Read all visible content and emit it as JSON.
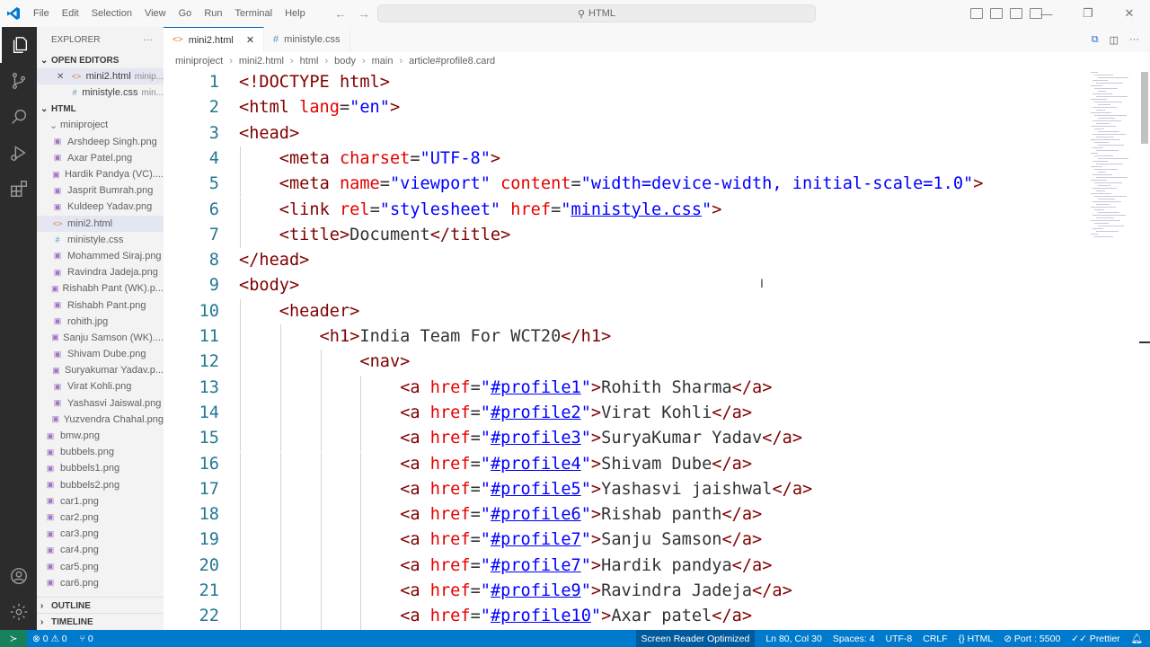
{
  "titlebar": {
    "menu": [
      "File",
      "Edit",
      "Selection",
      "View",
      "Go",
      "Run",
      "Terminal",
      "Help"
    ],
    "search": "HTML"
  },
  "sidebar": {
    "title": "EXPLORER",
    "open_editors_label": "OPEN EDITORS",
    "open_editors": [
      {
        "name": "mini2.html",
        "desc": "minip...",
        "type": "html"
      },
      {
        "name": "ministyle.css",
        "desc": "min...",
        "type": "css"
      }
    ],
    "folder_label": "HTML",
    "subfolder": "miniproject",
    "subfiles": [
      {
        "name": "Arshdeep Singh.png",
        "type": "img"
      },
      {
        "name": "Axar Patel.png",
        "type": "img"
      },
      {
        "name": "Hardik Pandya (VC)....",
        "type": "img"
      },
      {
        "name": "Jasprit Bumrah.png",
        "type": "img"
      },
      {
        "name": "Kuldeep Yadav.png",
        "type": "img"
      },
      {
        "name": "mini2.html",
        "type": "html"
      },
      {
        "name": "ministyle.css",
        "type": "css"
      },
      {
        "name": "Mohammed Siraj.png",
        "type": "img"
      },
      {
        "name": "Ravindra Jadeja.png",
        "type": "img"
      },
      {
        "name": "Rishabh Pant (WK).p...",
        "type": "img"
      },
      {
        "name": "Rishabh Pant.png",
        "type": "img"
      },
      {
        "name": "rohith.jpg",
        "type": "img"
      },
      {
        "name": "Sanju Samson (WK)....",
        "type": "img"
      },
      {
        "name": "Shivam Dube.png",
        "type": "img"
      },
      {
        "name": "Suryakumar Yadav.p...",
        "type": "img"
      },
      {
        "name": "Virat Kohli.png",
        "type": "img"
      },
      {
        "name": "Yashasvi Jaiswal.png",
        "type": "img"
      },
      {
        "name": "Yuzvendra Chahal.png",
        "type": "img"
      }
    ],
    "rootfiles": [
      "bmw.png",
      "bubbels.png",
      "bubbels1.png",
      "bubbels2.png",
      "car1.png",
      "car2.png",
      "car3.png",
      "car4.png",
      "car5.png",
      "car6.png"
    ],
    "outline_label": "OUTLINE",
    "timeline_label": "TIMELINE"
  },
  "tabs": [
    {
      "label": "mini2.html",
      "active": true
    },
    {
      "label": "ministyle.css",
      "active": false
    }
  ],
  "breadcrumb": [
    "miniproject",
    "mini2.html",
    "html",
    "body",
    "main",
    "article#profile8.card"
  ],
  "code_lines": [
    {
      "n": "1",
      "indent": 0,
      "tokens": [
        [
          "t",
          "<!DOCTYPE html>"
        ]
      ]
    },
    {
      "n": "2",
      "indent": 0,
      "tokens": [
        [
          "t",
          "<html "
        ],
        [
          "a",
          "lang"
        ],
        [
          "p",
          "="
        ],
        [
          "s",
          "\"en\""
        ],
        [
          "t",
          ">"
        ]
      ]
    },
    {
      "n": "3",
      "indent": 0,
      "tokens": [
        [
          "t",
          "<head>"
        ]
      ]
    },
    {
      "n": "4",
      "indent": 1,
      "tokens": [
        [
          "t",
          "<meta "
        ],
        [
          "a",
          "charset"
        ],
        [
          "p",
          "="
        ],
        [
          "s",
          "\"UTF-8\""
        ],
        [
          "t",
          ">"
        ]
      ]
    },
    {
      "n": "5",
      "indent": 1,
      "tokens": [
        [
          "t",
          "<meta "
        ],
        [
          "a",
          "name"
        ],
        [
          "p",
          "="
        ],
        [
          "s",
          "\"viewport\" "
        ],
        [
          "a",
          "content"
        ],
        [
          "p",
          "="
        ],
        [
          "s",
          "\"width=device-width, initial-scale=1.0\""
        ],
        [
          "t",
          ">"
        ]
      ]
    },
    {
      "n": "6",
      "indent": 1,
      "tokens": [
        [
          "t",
          "<link "
        ],
        [
          "a",
          "rel"
        ],
        [
          "p",
          "="
        ],
        [
          "s",
          "\"stylesheet\" "
        ],
        [
          "a",
          "href"
        ],
        [
          "p",
          "="
        ],
        [
          "s",
          "\""
        ],
        [
          "u",
          "ministyle.css"
        ],
        [
          "s",
          "\""
        ],
        [
          "t",
          ">"
        ]
      ]
    },
    {
      "n": "7",
      "indent": 1,
      "tokens": [
        [
          "t",
          "<title>"
        ],
        [
          "p",
          "Document"
        ],
        [
          "t",
          "</title>"
        ]
      ]
    },
    {
      "n": "8",
      "indent": 0,
      "tokens": [
        [
          "t",
          "</head>"
        ]
      ]
    },
    {
      "n": "9",
      "indent": 0,
      "tokens": [
        [
          "t",
          "<body>"
        ]
      ]
    },
    {
      "n": "10",
      "indent": 1,
      "tokens": [
        [
          "t",
          "<header>"
        ]
      ]
    },
    {
      "n": "11",
      "indent": 2,
      "tokens": [
        [
          "t",
          "<h1>"
        ],
        [
          "p",
          "India Team For WCT20"
        ],
        [
          "t",
          "</h1>"
        ]
      ]
    },
    {
      "n": "12",
      "indent": 3,
      "tokens": [
        [
          "t",
          "<nav>"
        ]
      ]
    },
    {
      "n": "13",
      "indent": 4,
      "tokens": [
        [
          "t",
          "<a "
        ],
        [
          "a",
          "href"
        ],
        [
          "p",
          "="
        ],
        [
          "s",
          "\""
        ],
        [
          "u",
          "#profile1"
        ],
        [
          "s",
          "\""
        ],
        [
          "t",
          ">"
        ],
        [
          "p",
          "Rohith Sharma"
        ],
        [
          "t",
          "</a>"
        ]
      ]
    },
    {
      "n": "14",
      "indent": 4,
      "tokens": [
        [
          "t",
          "<a "
        ],
        [
          "a",
          "href"
        ],
        [
          "p",
          "="
        ],
        [
          "s",
          "\""
        ],
        [
          "u",
          "#profile2"
        ],
        [
          "s",
          "\""
        ],
        [
          "t",
          ">"
        ],
        [
          "p",
          "Virat Kohli"
        ],
        [
          "t",
          "</a>"
        ]
      ]
    },
    {
      "n": "15",
      "indent": 4,
      "tokens": [
        [
          "t",
          "<a "
        ],
        [
          "a",
          "href"
        ],
        [
          "p",
          "="
        ],
        [
          "s",
          "\""
        ],
        [
          "u",
          "#profile3"
        ],
        [
          "s",
          "\""
        ],
        [
          "t",
          ">"
        ],
        [
          "p",
          "SuryaKumar Yadav"
        ],
        [
          "t",
          "</a>"
        ]
      ]
    },
    {
      "n": "16",
      "indent": 4,
      "tokens": [
        [
          "t",
          "<a "
        ],
        [
          "a",
          "href"
        ],
        [
          "p",
          "="
        ],
        [
          "s",
          "\""
        ],
        [
          "u",
          "#profile4"
        ],
        [
          "s",
          "\""
        ],
        [
          "t",
          ">"
        ],
        [
          "p",
          "Shivam Dube"
        ],
        [
          "t",
          "</a>"
        ]
      ]
    },
    {
      "n": "17",
      "indent": 4,
      "tokens": [
        [
          "t",
          "<a "
        ],
        [
          "a",
          "href"
        ],
        [
          "p",
          "="
        ],
        [
          "s",
          "\""
        ],
        [
          "u",
          "#profile5"
        ],
        [
          "s",
          "\""
        ],
        [
          "t",
          ">"
        ],
        [
          "p",
          "Yashasvi jaishwal"
        ],
        [
          "t",
          "</a>"
        ]
      ]
    },
    {
      "n": "18",
      "indent": 4,
      "tokens": [
        [
          "t",
          "<a "
        ],
        [
          "a",
          "href"
        ],
        [
          "p",
          "="
        ],
        [
          "s",
          "\""
        ],
        [
          "u",
          "#profile6"
        ],
        [
          "s",
          "\""
        ],
        [
          "t",
          ">"
        ],
        [
          "p",
          "Rishab panth"
        ],
        [
          "t",
          "</a>"
        ]
      ]
    },
    {
      "n": "19",
      "indent": 4,
      "tokens": [
        [
          "t",
          "<a "
        ],
        [
          "a",
          "href"
        ],
        [
          "p",
          "="
        ],
        [
          "s",
          "\""
        ],
        [
          "u",
          "#profile7"
        ],
        [
          "s",
          "\""
        ],
        [
          "t",
          ">"
        ],
        [
          "p",
          "Sanju Samson"
        ],
        [
          "t",
          "</a>"
        ]
      ]
    },
    {
      "n": "20",
      "indent": 4,
      "tokens": [
        [
          "t",
          "<a "
        ],
        [
          "a",
          "href"
        ],
        [
          "p",
          "="
        ],
        [
          "s",
          "\""
        ],
        [
          "u",
          "#profile7"
        ],
        [
          "s",
          "\""
        ],
        [
          "t",
          ">"
        ],
        [
          "p",
          "Hardik pandya"
        ],
        [
          "t",
          "</a>"
        ]
      ]
    },
    {
      "n": "21",
      "indent": 4,
      "tokens": [
        [
          "t",
          "<a "
        ],
        [
          "a",
          "href"
        ],
        [
          "p",
          "="
        ],
        [
          "s",
          "\""
        ],
        [
          "u",
          "#profile9"
        ],
        [
          "s",
          "\""
        ],
        [
          "t",
          ">"
        ],
        [
          "p",
          "Ravindra Jadeja"
        ],
        [
          "t",
          "</a>"
        ]
      ]
    },
    {
      "n": "22",
      "indent": 4,
      "tokens": [
        [
          "t",
          "<a "
        ],
        [
          "a",
          "href"
        ],
        [
          "p",
          "="
        ],
        [
          "s",
          "\""
        ],
        [
          "u",
          "#profile10"
        ],
        [
          "s",
          "\""
        ],
        [
          "t",
          ">"
        ],
        [
          "p",
          "Axar patel"
        ],
        [
          "t",
          "</a>"
        ]
      ]
    }
  ],
  "statusbar": {
    "problems": "⊗ 0 ⚠ 0",
    "ports": "⑂ 0",
    "screen_reader": "Screen Reader Optimized",
    "position": "Ln 80, Col 30",
    "spaces": "Spaces: 4",
    "encoding": "UTF-8",
    "eol": "CRLF",
    "language": "{} HTML",
    "port": "⊘ Port : 5500",
    "prettier": "✓✓ Prettier"
  }
}
